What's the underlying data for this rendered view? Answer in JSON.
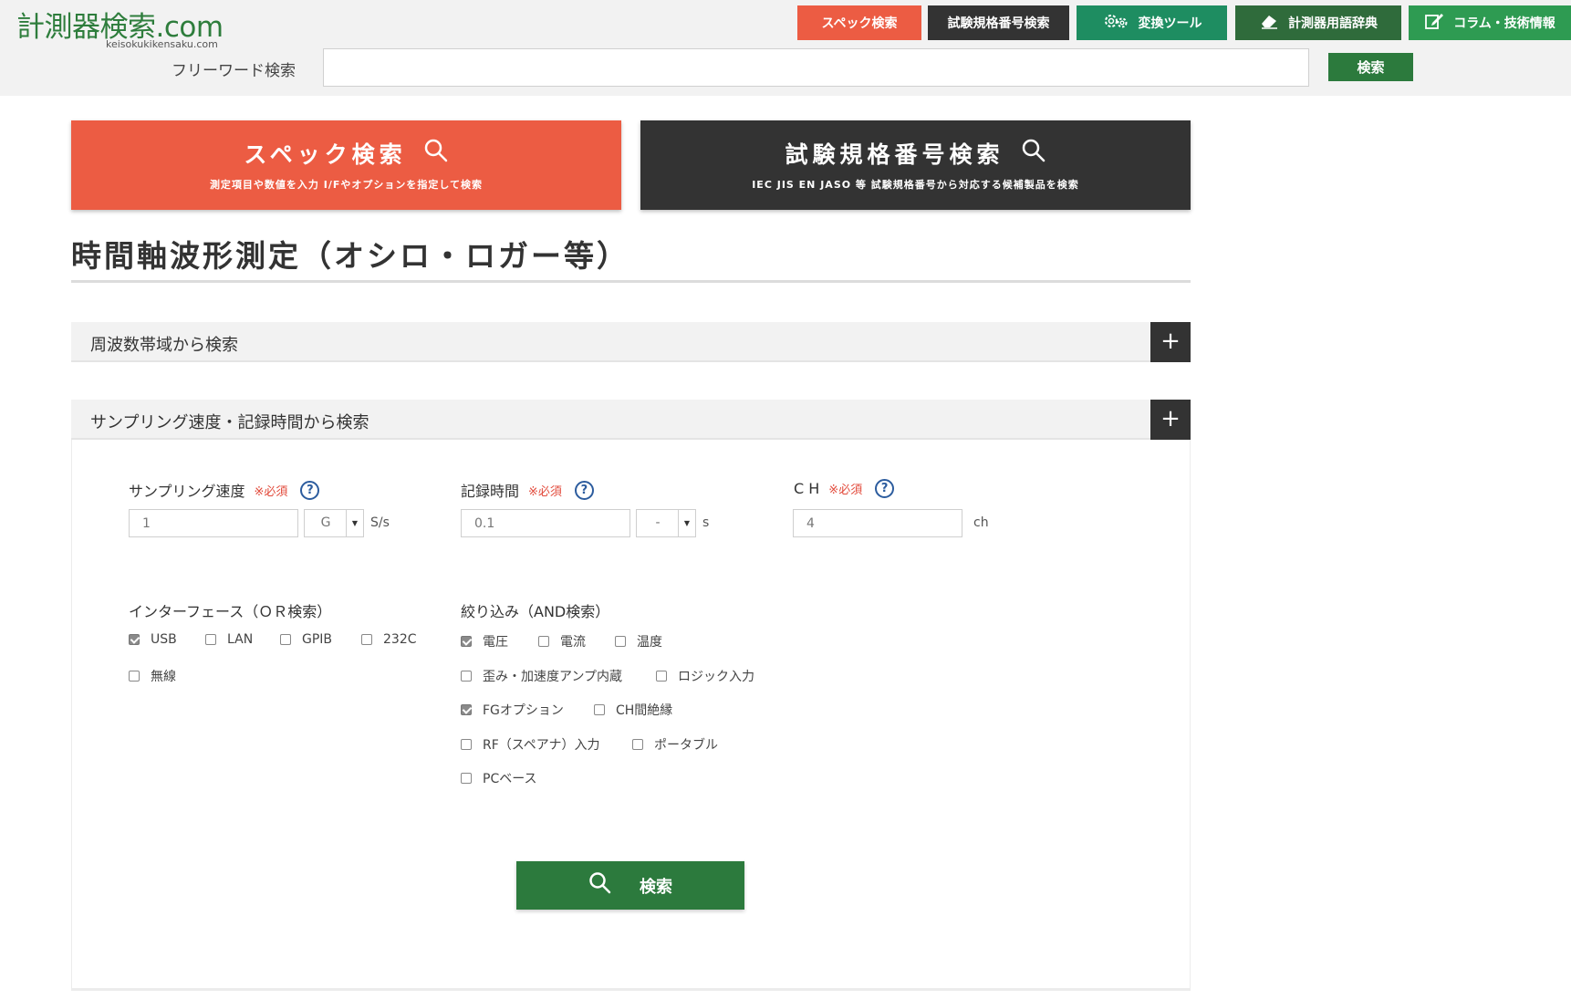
{
  "header": {
    "logo": "計測器検索.com",
    "logo_sub": "keisokukikensaku.com",
    "nav": [
      {
        "label": "スペック検索",
        "color": "#ec5c43"
      },
      {
        "label": "試験規格番号検索",
        "color": "#333333"
      },
      {
        "label": "変換ツール",
        "color": "#1e8d61"
      },
      {
        "label": "計測器用語辞典",
        "color": "#2f6b3b"
      },
      {
        "label": "コラム・技術情報",
        "color": "#2e9b52"
      }
    ],
    "freeword_label": "フリーワード検索",
    "freeword_value": "",
    "search_label": "検索"
  },
  "banners": {
    "spec": {
      "title": "スペック検索",
      "subtitle": "測定項目や数値を入力 I/Fやオプションを指定して検索"
    },
    "standard": {
      "title": "試験規格番号検索",
      "subtitle": "IEC JIS EN JASO 等 試験規格番号から対応する候補製品を検索"
    }
  },
  "page_title": "時間軸波形測定（オシロ・ロガー等）",
  "accordions": {
    "frequency": {
      "label": "周波数帯域から検索",
      "icon": "plus-icon"
    },
    "sampling": {
      "label": "サンプリング速度・記録時間から検索",
      "icon": "plus-icon"
    }
  },
  "form": {
    "required_mark": "※必須",
    "help": "?",
    "sampling_rate": {
      "label": "サンプリング速度",
      "value": "1",
      "prefix": "G",
      "unit": "S/s"
    },
    "record_time": {
      "label": "記録時間",
      "value": "0.1",
      "prefix": "-",
      "unit": "s"
    },
    "ch": {
      "label": "C H",
      "value": "4",
      "unit": "ch"
    },
    "interface": {
      "label": "インターフェース（ＯＲ検索）",
      "options": [
        {
          "label": "USB",
          "checked": true
        },
        {
          "label": "LAN",
          "checked": false
        },
        {
          "label": "GPIB",
          "checked": false
        },
        {
          "label": "232C",
          "checked": false
        },
        {
          "label": "無線",
          "checked": false
        }
      ]
    },
    "filter": {
      "label": "絞り込み（AND検索）",
      "options": [
        {
          "label": "電圧",
          "checked": true
        },
        {
          "label": "電流",
          "checked": false
        },
        {
          "label": "温度",
          "checked": false
        },
        {
          "label": "歪み・加速度アンプ内蔵",
          "checked": false
        },
        {
          "label": "ロジック入力",
          "checked": false
        },
        {
          "label": "FGオプション",
          "checked": true
        },
        {
          "label": "CH間絶縁",
          "checked": false
        },
        {
          "label": "RF（スペアナ）入力",
          "checked": false
        },
        {
          "label": "ポータブル",
          "checked": false
        },
        {
          "label": "PCベース",
          "checked": false
        }
      ]
    },
    "submit_label": "検索"
  }
}
